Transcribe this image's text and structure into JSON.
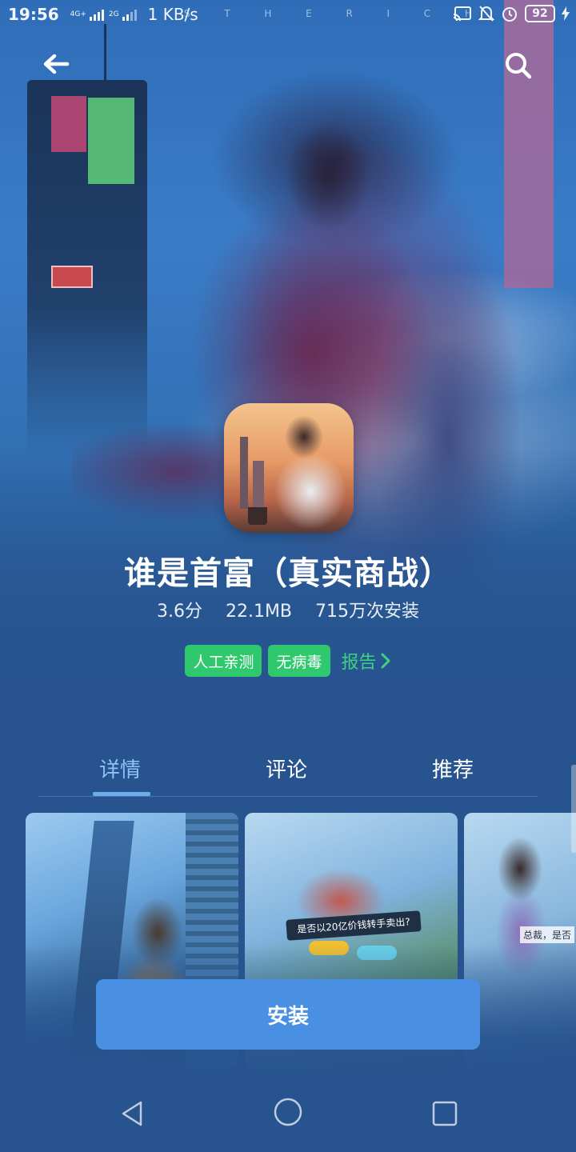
{
  "status_bar": {
    "time": "19:56",
    "net_small_top": "4G+",
    "net_small_2": "2G",
    "speed": "1 KB/s",
    "marquee": [
      "S",
      "T",
      "H",
      "E",
      "R",
      "I",
      "C",
      "H"
    ],
    "battery": "92",
    "icons": [
      "cast-icon",
      "bell-off-icon",
      "alarm-icon",
      "battery-icon",
      "charging-icon"
    ]
  },
  "top_nav": {
    "back_icon": "arrow-left-icon",
    "search_icon": "search-icon"
  },
  "app": {
    "title": "谁是首富（真实商战）",
    "rating": "3.6分",
    "size": "22.1MB",
    "installs": "715万次安装",
    "tags": [
      "人工亲测",
      "无病毒"
    ],
    "report_label": "报告"
  },
  "tabs": [
    {
      "label": "详情",
      "active": true
    },
    {
      "label": "评论",
      "active": false
    },
    {
      "label": "推荐",
      "active": false
    }
  ],
  "screenshots": {
    "shot2_banner": "是否以20亿价钱转手卖出?",
    "shot3_caption": "总裁，是否"
  },
  "install_label": "安装",
  "colors": {
    "accent": "#4a90e2",
    "tag_green": "#2fc86e",
    "tab_active": "#8fc2f4",
    "background": "#27548f"
  }
}
